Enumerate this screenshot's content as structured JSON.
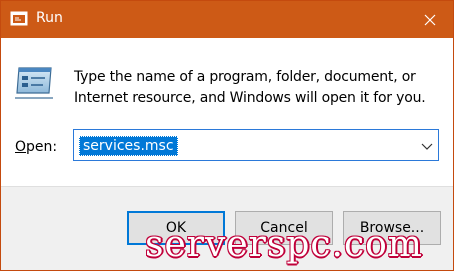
{
  "window": {
    "title": "Run",
    "title_icon": "run-icon",
    "close_icon": "close-icon",
    "titlebar_color": "#cd5a16"
  },
  "main": {
    "app_icon": "run-app-icon",
    "description": "Type the name of a program, folder, document, or Internet resource, and Windows will open it for you.",
    "open_label": "Open:",
    "open_label_accelerator": "O",
    "open_label_rest": "pen:",
    "open_value": "services.msc",
    "dropdown_icon": "chevron-down-icon"
  },
  "buttons": {
    "ok": "OK",
    "cancel": "Cancel",
    "browse": "Browse..."
  },
  "watermark": {
    "text": "serverspc.com"
  },
  "colors": {
    "accent": "#0078d7",
    "watermark": "#c0003a"
  }
}
